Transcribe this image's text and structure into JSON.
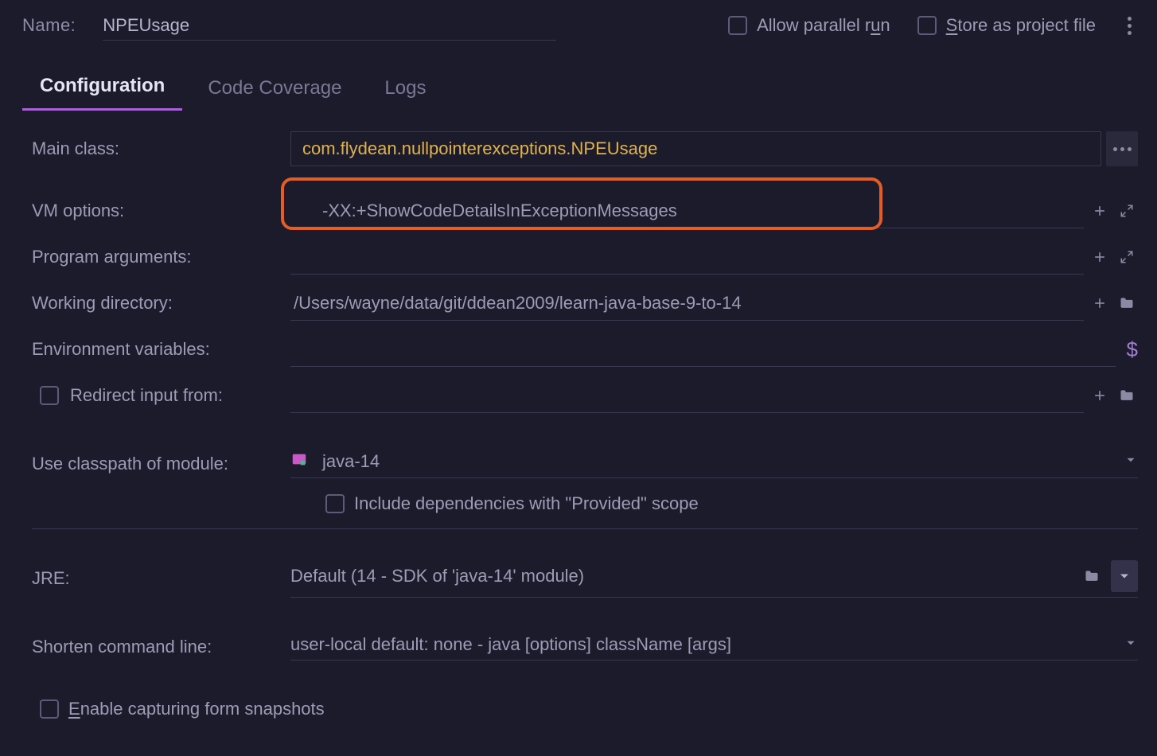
{
  "header": {
    "name_label": "Name:",
    "name_value": "NPEUsage",
    "allow_parallel_pre": "Allow parallel r",
    "allow_parallel_mn": "u",
    "allow_parallel_post": "n",
    "store_pre": "",
    "store_mn": "S",
    "store_post": "tore as project file"
  },
  "tabs": [
    {
      "label": "Configuration",
      "active": true
    },
    {
      "label": "Code Coverage",
      "active": false
    },
    {
      "label": "Logs",
      "active": false
    }
  ],
  "fields": {
    "main_class_label": "Main class:",
    "main_class_value": "com.flydean.nullpointerexceptions.NPEUsage",
    "vm_options_label": "VM options:",
    "vm_options_value": "-XX:+ShowCodeDetailsInExceptionMessages",
    "program_args_label": "Program arguments:",
    "program_args_value": "",
    "working_dir_label": "Working directory:",
    "working_dir_value": "/Users/wayne/data/git/ddean2009/learn-java-base-9-to-14",
    "env_vars_label": "Environment variables:",
    "env_vars_value": "",
    "redirect_label": "Redirect input from:",
    "redirect_value": "",
    "classpath_label": "Use classpath of module:",
    "classpath_value": "java-14",
    "include_provided_label": "Include dependencies with \"Provided\" scope",
    "jre_label": "JRE:",
    "jre_value": "Default (14 - SDK of 'java-14' module)",
    "shorten_label": "Shorten command line:",
    "shorten_value": "user-local default: none - java [options] className [args]",
    "enable_snapshots_pre": "",
    "enable_snapshots_mn": "E",
    "enable_snapshots_post": "nable capturing form snapshots"
  },
  "icons": {
    "plus": "plus-icon",
    "expand": "expand-icon",
    "folder": "folder-icon",
    "ellipsis": "ellipsis-icon",
    "dollar": "$",
    "chevron_down": "chevron-down-icon",
    "kebab": "kebab-vertical-icon"
  },
  "colors": {
    "accent": "#a862d7",
    "highlight_border": "#e35d27",
    "yellow_text": "#dfb24f"
  }
}
